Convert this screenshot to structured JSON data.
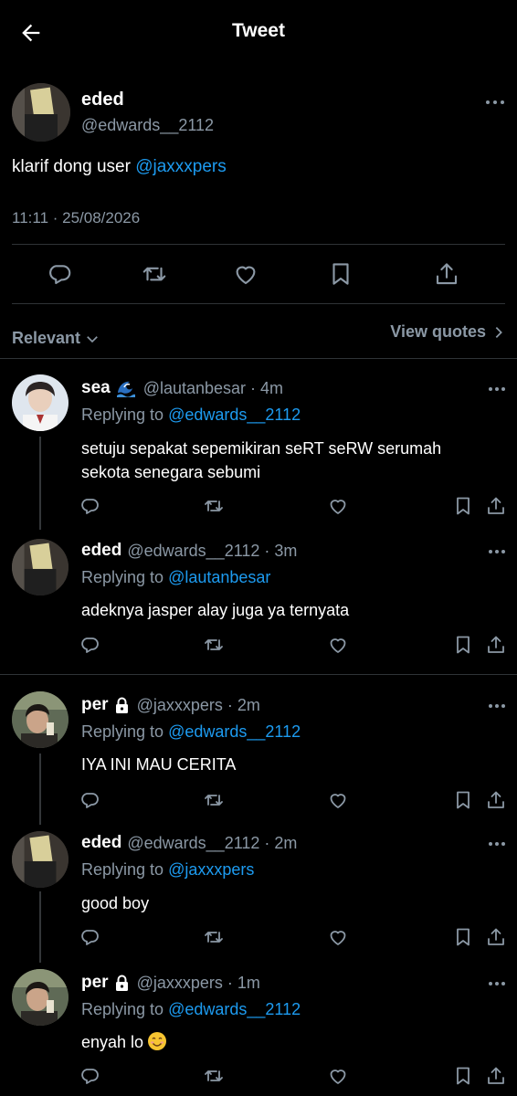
{
  "header": {
    "title": "Tweet",
    "back_icon": "arrow-left-icon"
  },
  "main_tweet": {
    "name": "eded",
    "handle": "@edwards__2112",
    "text": "klarif dong user ",
    "mention": "@jaxxxpers",
    "timestamp": "11:11 · 25/08/2026"
  },
  "sort": {
    "label": "Relevant",
    "view_quotes": "View quotes"
  },
  "replies": [
    {
      "name": "sea",
      "meta": "@lautanbesar · 4m",
      "replying_prefix": "Replying to ",
      "replying_to": "@edwards__2112",
      "text": "setuju sepakat sepemikiran seRT seRW serumah sekota senegara sebumi",
      "badge": "wave-emoji"
    },
    {
      "name": "eded",
      "meta": "@edwards__2112 · 3m",
      "replying_prefix": "Replying to ",
      "replying_to": "@lautanbesar",
      "text": "adeknya jasper alay juga ya ternyata"
    },
    {
      "name": "per",
      "meta": "@jaxxxpers · 2m",
      "replying_prefix": "Replying to ",
      "replying_to": "@edwards__2112",
      "text": "IYA INI MAU CERITA",
      "badge": "lock-icon"
    },
    {
      "name": "eded",
      "meta": "@edwards__2112 · 2m",
      "replying_prefix": "Replying to ",
      "replying_to": "@jaxxxpers",
      "text": "good boy"
    },
    {
      "name": "per",
      "meta": "@jaxxxpers · 1m",
      "replying_prefix": "Replying to ",
      "replying_to": "@edwards__2112",
      "text": "enyah lo",
      "badge": "lock-icon",
      "emoji": "smiling-face-emoji"
    }
  ],
  "colors": {
    "background": "#000000",
    "accent": "#1d9bf0",
    "muted": "#8b98a5",
    "divider": "#2f3336"
  }
}
